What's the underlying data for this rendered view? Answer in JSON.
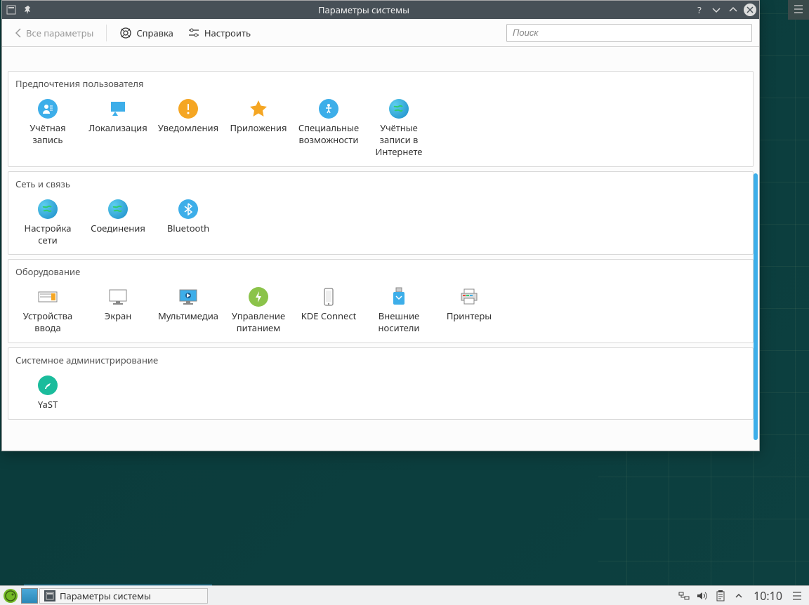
{
  "window": {
    "title": "Параметры системы"
  },
  "toolbar": {
    "back_label": "Все параметры",
    "help_label": "Справка",
    "configure_label": "Настроить",
    "search_placeholder": "Поиск"
  },
  "sections": {
    "user_prefs": {
      "title": "Предпочтения пользователя",
      "items": {
        "account": "Учётная запись",
        "localization": "Локализация",
        "notifications": "Уведомления",
        "applications": "Приложения",
        "accessibility": "Специальные возможности",
        "online_accounts": "Учётные записи в Интернете"
      }
    },
    "network": {
      "title": "Сеть и связь",
      "items": {
        "net_settings": "Настройка сети",
        "connections": "Соединения",
        "bluetooth": "Bluetooth"
      }
    },
    "hardware": {
      "title": "Оборудование",
      "items": {
        "input_devices": "Устройства ввода",
        "display": "Экран",
        "multimedia": "Мультимедиа",
        "power": "Управление питанием",
        "kdeconnect": "KDE Connect",
        "removable": "Внешние носители",
        "printers": "Принтеры"
      }
    },
    "sysadmin": {
      "title": "Системное администрирование",
      "items": {
        "yast": "YaST"
      }
    }
  },
  "taskbar": {
    "task_label": "Параметры системы",
    "clock": "10:10"
  }
}
